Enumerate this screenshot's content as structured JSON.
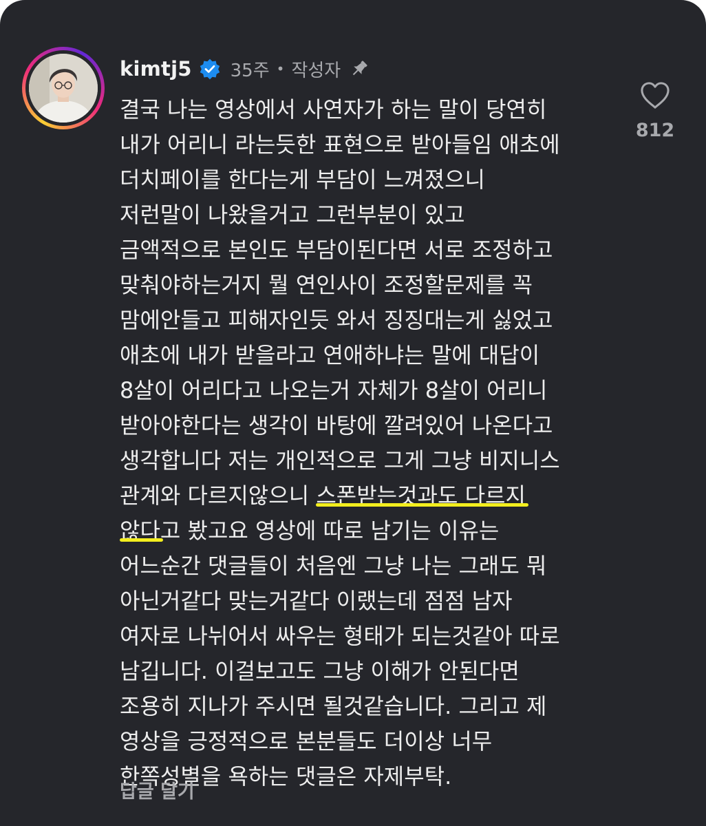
{
  "comment": {
    "username": "kimtj5",
    "age": "35주",
    "separator": "•",
    "author_label": "작성자",
    "lines": [
      "결국 나는 영상에서 사연자가 하는 말이 당연히",
      "내가 어리니 라는듯한 표현으로 받아들임 애초에",
      "더치페이를 한다는게 부담이 느껴졌으니",
      "저런말이 나왔을거고 그런부분이 있고",
      "금액적으로 본인도 부담이된다면 서로 조정하고",
      "맞춰야하는거지 뭘 연인사이 조정할문제를 꼭",
      "맘에안들고 피해자인듯 와서 징징대는게 싫었고",
      "애초에 내가 받을라고 연애하냐는 말에 대답이",
      "8살이 어리다고 나오는거 자체가 8살이 어리니",
      "받아야한다는 생각이 바탕에 깔려있어 나온다고",
      "생각합니다 저는 개인적으로 그게 그냥 비지니스",
      {
        "before": "관계와 다르지않으니 ",
        "highlight": "스폰받는것과도 다르지"
      },
      {
        "highlight": "않다",
        "after": "고 봤고요 영상에 따로 남기는 이유는"
      },
      "어느순간 댓글들이 처음엔 그냥 나는 그래도 뭐",
      "아닌거같다 맞는거같다 이랬는데 점점 남자",
      "여자로 나뉘어서 싸우는 형태가 되는것같아 따로",
      "남깁니다. 이걸보고도 그냥 이해가 안된다면",
      "조용히 지나가 주시면 될것같습니다. 그리고 제",
      "영상을 긍정적으로 본분들도 더이상 너무",
      "한쪽성별을 욕하는 댓글은 자제부탁."
    ],
    "like_count": "812",
    "reply_label": "답글 달기"
  },
  "icons": {
    "verified": "verified-badge-icon",
    "pin": "pin-icon",
    "like": "heart-icon",
    "avatar": "profile-avatar"
  },
  "colors": {
    "background": "#25262b",
    "text": "#ededed",
    "muted": "#a8a9ad",
    "verified": "#1d8cf0",
    "highlight": "#f3ee1e"
  }
}
